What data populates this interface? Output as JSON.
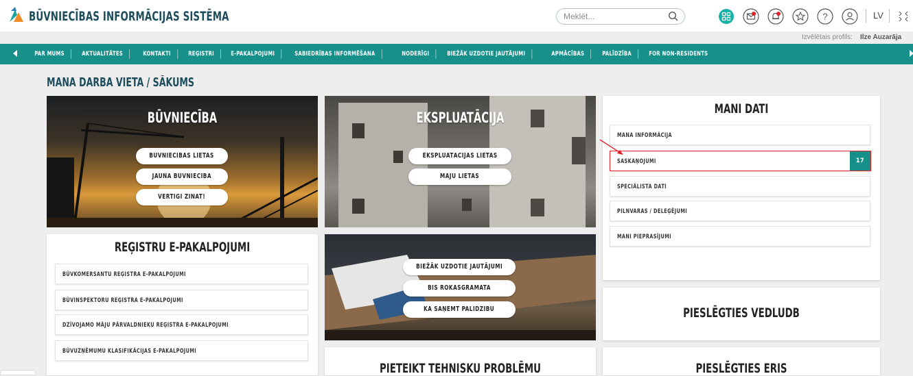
{
  "header": {
    "title": "BŪVNIECĪBAS INFORMĀCIJAS SISTĒMA",
    "search_placeholder": "Meklēt...",
    "lang": "LV",
    "profile_label": "Izvēlētais profils:",
    "profile_name": "Ilze Auzarāja",
    "icons": [
      "apps-icon",
      "mail-icon",
      "notification-icon",
      "star-icon",
      "help-icon",
      "user-icon",
      "collapse-icon"
    ]
  },
  "nav": {
    "items": [
      "PAR MUMS",
      "AKTUALITĀTES",
      "KONTAKTI",
      "REĢISTRI",
      "E-PAKALPOJUMI",
      "SABIEDRĪBAS INFORMĒŠANA",
      "NODERĪGI",
      "BIEŽĀK UZDOTIE JAUTĀJUMI",
      "APMĀCĪBAS",
      "PALĪDZĪBA",
      "FOR NON-RESIDENTS"
    ]
  },
  "page_title": "MANA DARBA VIETA / SĀKUMS",
  "buvnieciba": {
    "title": "BŪVNIECĪBA",
    "links": [
      "BŪVNIECĪBAS LIETAS",
      "JAUNA BŪVNIECĪBA",
      "VĒRTĪGI ZINĀT!"
    ]
  },
  "ekspluatacija": {
    "title": "EKSPLUATĀCIJA",
    "links": [
      "EKSPLUATĀCIJAS LIETAS",
      "MĀJU LIETAS"
    ]
  },
  "mani_dati": {
    "title": "MANI DATI",
    "items": [
      "MANA INFORMĀCIJA",
      "SASKAŅOJUMI",
      "SPECIĀLISTA DATI",
      "PILNVARAS / DELEĢĒJUMI",
      "MANI PIEPRASĪJUMI"
    ],
    "saskanojumi_count": "17"
  },
  "registri": {
    "title": "REĢISTRU E-PAKALPOJUMI",
    "items": [
      "BŪVKOMERSANTU REĢISTRA E-PAKALPOJUMI",
      "BŪVINSPEKTORU REĢISTRA E-PAKALPOJUMI",
      "DZĪVOJAMO MĀJU PĀRVALDNIEKU REĢISTRA E-PAKALPOJUMI",
      "BŪVUZŅĒMUMU KLASIFIKĀCIJAS E-PAKALPOJUMI"
    ]
  },
  "palidziba": {
    "links": [
      "BIEŽĀK UZDOTIE JAUTĀJUMI",
      "BIS ROKASGRĀMATA",
      "KĀ SAŅEMT PALĪDZĪBU"
    ]
  },
  "vedludb": "PIESLĒGTIES VEDLUDB",
  "tehniskas": "PIETEIKT TEHNISKU PROBLĒMU",
  "eris": "PIESLĒGTIES ERIS",
  "colors": {
    "teal": "#17908c",
    "navy": "#1d4d5c",
    "highlight": "#e2222a",
    "orange": "#f28c28"
  }
}
